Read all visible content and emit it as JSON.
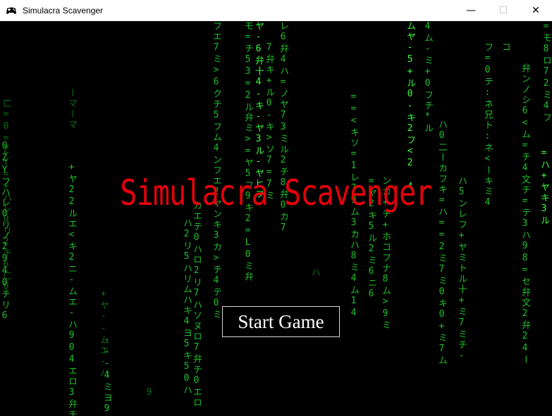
{
  "window": {
    "title": "Simulacra Scavenger",
    "icon": "gamepad-icon",
    "controls": {
      "minimize": "—",
      "maximize": "☐",
      "close": "✕"
    }
  },
  "game": {
    "title": "Simulacra Scavenger",
    "start_button": "Start Game",
    "colors": {
      "background": "#000000",
      "rain": "#1fbf2a",
      "title": "#e8000b",
      "button_border": "#d8d8d8",
      "button_text": "#ffffff"
    }
  }
}
